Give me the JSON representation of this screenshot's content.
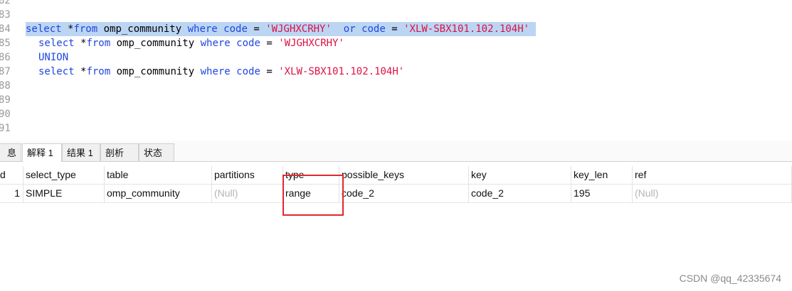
{
  "editor": {
    "lines": [
      {
        "num": "82",
        "tokens": []
      },
      {
        "num": "83",
        "tokens": []
      },
      {
        "num": "84",
        "selected": true,
        "indent": false,
        "tokens": [
          {
            "t": "select",
            "c": "kw"
          },
          {
            "t": " *",
            "c": "op"
          },
          {
            "t": "from",
            "c": "kw"
          },
          {
            "t": " omp_community ",
            "c": "id"
          },
          {
            "t": "where",
            "c": "kw"
          },
          {
            "t": " code",
            "c": "kw"
          },
          {
            "t": " = ",
            "c": "op"
          },
          {
            "t": "'WJGHXCRHY'",
            "c": "str"
          },
          {
            "t": "  or",
            "c": "kw"
          },
          {
            "t": " code",
            "c": "kw"
          },
          {
            "t": " = ",
            "c": "op"
          },
          {
            "t": "'XLW-SBX101.102.104H'",
            "c": "str"
          },
          {
            "t": " ",
            "c": "op"
          }
        ]
      },
      {
        "num": "85",
        "indent": true,
        "tokens": [
          {
            "t": "select",
            "c": "kw"
          },
          {
            "t": " *",
            "c": "op"
          },
          {
            "t": "from",
            "c": "kw"
          },
          {
            "t": " omp_community ",
            "c": "id"
          },
          {
            "t": "where",
            "c": "kw"
          },
          {
            "t": " code",
            "c": "kw"
          },
          {
            "t": " = ",
            "c": "op"
          },
          {
            "t": "'WJGHXCRHY'",
            "c": "str"
          }
        ]
      },
      {
        "num": "86",
        "indent": true,
        "tokens": [
          {
            "t": "UNION",
            "c": "kw"
          }
        ]
      },
      {
        "num": "87",
        "indent": true,
        "tokens": [
          {
            "t": "select",
            "c": "kw"
          },
          {
            "t": " *",
            "c": "op"
          },
          {
            "t": "from",
            "c": "kw"
          },
          {
            "t": " omp_community ",
            "c": "id"
          },
          {
            "t": "where",
            "c": "kw"
          },
          {
            "t": " code",
            "c": "kw"
          },
          {
            "t": " = ",
            "c": "op"
          },
          {
            "t": "'XLW-SBX101.102.104H'",
            "c": "str"
          }
        ]
      },
      {
        "num": "88",
        "tokens": []
      },
      {
        "num": "89",
        "tokens": []
      },
      {
        "num": "90",
        "tokens": []
      },
      {
        "num": "91",
        "tokens": []
      }
    ]
  },
  "tabs": [
    {
      "label": "息",
      "active": false
    },
    {
      "label": "解释 1",
      "active": true
    },
    {
      "label": "结果 1",
      "active": false
    },
    {
      "label": "剖析",
      "active": false
    },
    {
      "label": "状态",
      "active": false
    }
  ],
  "grid": {
    "columns": [
      "d",
      "select_type",
      "table",
      "partitions",
      "type",
      "possible_keys",
      "key",
      "key_len",
      "ref"
    ],
    "rows": [
      [
        "1",
        "SIMPLE",
        "omp_community",
        "(Null)",
        "range",
        "code_2",
        "code_2",
        "195",
        "(Null)"
      ]
    ]
  },
  "watermark": "CSDN @qq_42335674"
}
